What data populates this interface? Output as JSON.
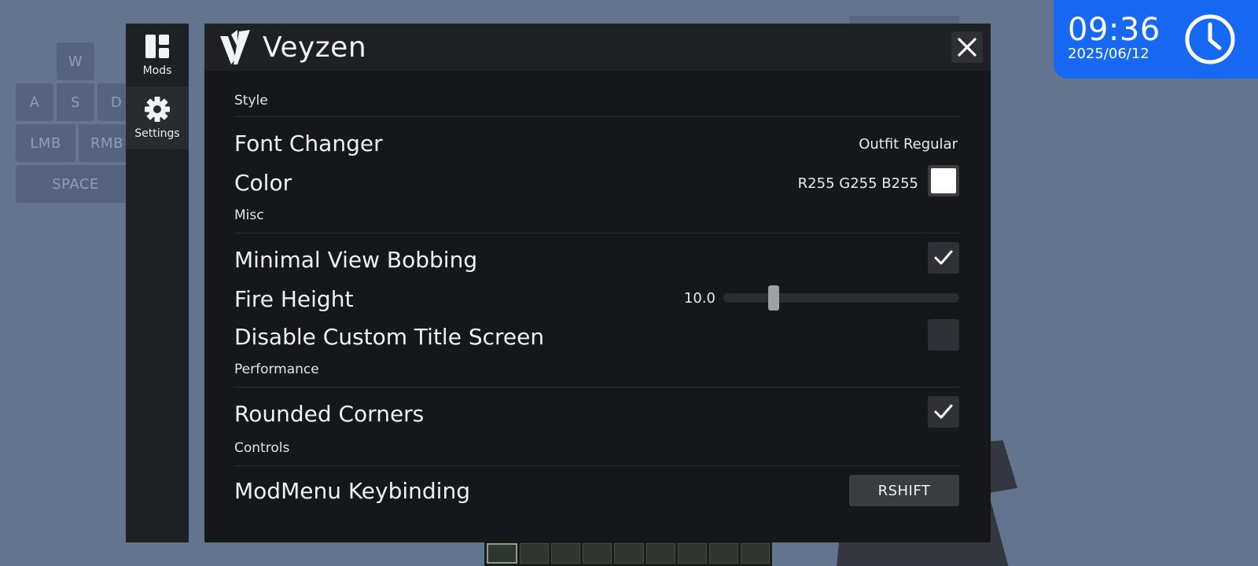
{
  "keystrokes": {
    "w": "W",
    "a": "A",
    "s": "S",
    "d": "D",
    "lmb": "LMB",
    "rmb": "RMB",
    "space": "SPACE"
  },
  "sidebar": {
    "items": [
      {
        "label": "Mods",
        "icon": "mods-grid-icon"
      },
      {
        "label": "Settings",
        "icon": "gear-icon"
      }
    ],
    "active": "Settings"
  },
  "header": {
    "title": "Veyzen",
    "logo_icon": "veyzen-logo-icon",
    "close_icon": "close-icon"
  },
  "sections": {
    "style": "Style",
    "misc": "Misc",
    "performance": "Performance",
    "controls": "Controls"
  },
  "settings": {
    "font_changer": {
      "label": "Font Changer",
      "value": "Outfit Regular"
    },
    "color": {
      "label": "Color",
      "value": "R255 G255 B255",
      "swatch": "#ffffff"
    },
    "minimal_view_bobbing": {
      "label": "Minimal View Bobbing",
      "checked": true
    },
    "fire_height": {
      "label": "Fire Height",
      "value": "10.0",
      "fraction": 0.2
    },
    "disable_custom_title_screen": {
      "label": "Disable Custom Title Screen",
      "checked": false
    },
    "rounded_corners": {
      "label": "Rounded Corners",
      "checked": true
    },
    "modmenu_keybinding": {
      "label": "ModMenu Keybinding",
      "value": "RSHIFT"
    }
  },
  "clock": {
    "time": "09:36",
    "date": "2025/06/12",
    "icon": "clock-icon"
  },
  "colors": {
    "background": "#63748f",
    "panel": "#16171a",
    "header": "#1f2023",
    "clock_accent": "#1769f3"
  }
}
